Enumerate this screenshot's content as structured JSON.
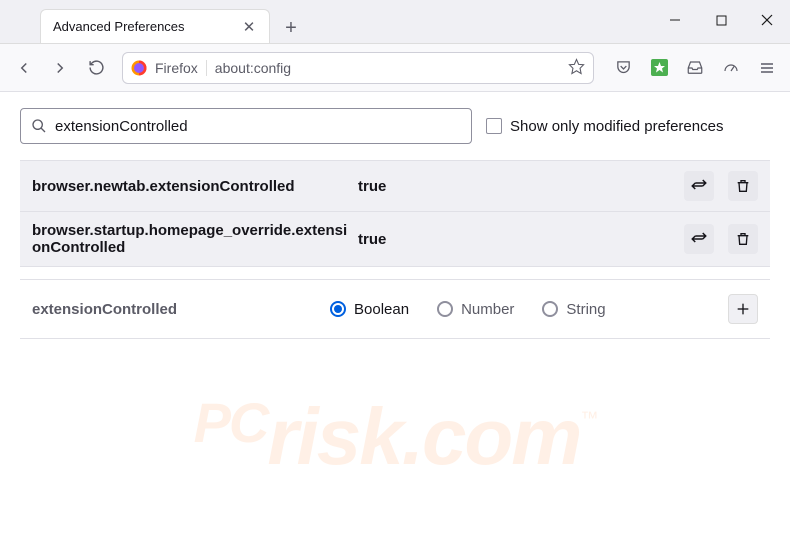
{
  "window": {
    "tab_title": "Advanced Preferences"
  },
  "urlbar": {
    "identity": "Firefox",
    "url": "about:config"
  },
  "search": {
    "value": "extensionControlled",
    "checkbox_label": "Show only modified preferences"
  },
  "prefs": [
    {
      "name": "browser.newtab.extensionControlled",
      "value": "true"
    },
    {
      "name": "browser.startup.homepage_override.extensionControlled",
      "value": "true"
    }
  ],
  "new_pref": {
    "name": "extensionControlled",
    "types": {
      "boolean": "Boolean",
      "number": "Number",
      "string": "String"
    }
  },
  "watermark": {
    "pc": "PC",
    "risk": "risk",
    "com": ".com",
    "tm": "™"
  }
}
